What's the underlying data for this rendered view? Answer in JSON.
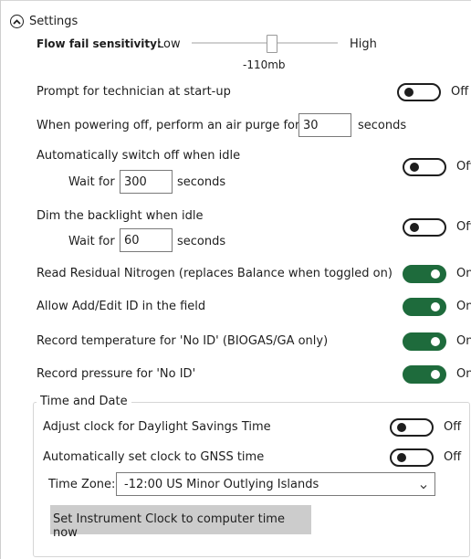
{
  "settings": {
    "title": "Settings",
    "flow_fail": {
      "label": "Flow fail sensitivity:",
      "low": "Low",
      "high": "High",
      "value": "-110mb"
    },
    "prompt_technician": {
      "label": "Prompt for technician at start-up",
      "state": "Off"
    },
    "air_purge": {
      "label": "When powering off, perform an air purge for",
      "value": "30",
      "unit": "seconds"
    },
    "auto_switch_off": {
      "label": "Automatically switch off when idle",
      "wait_label": "Wait for",
      "wait_value": "300",
      "unit": "seconds",
      "state": "Off"
    },
    "dim_backlight": {
      "label": "Dim the backlight when idle",
      "wait_label": "Wait for",
      "wait_value": "60",
      "unit": "seconds",
      "state": "Off"
    },
    "residual_nitrogen": {
      "label": "Read Residual Nitrogen (replaces Balance when toggled on)",
      "state": "On"
    },
    "add_edit_id": {
      "label": "Allow Add/Edit ID in the field",
      "state": "On"
    },
    "record_temp": {
      "label": "Record temperature for 'No ID' (BIOGAS/GA only)",
      "state": "On"
    },
    "record_pressure": {
      "label": "Record pressure for 'No ID'",
      "state": "On"
    }
  },
  "time_date": {
    "title": "Time and Date",
    "dst": {
      "label": "Adjust clock for Daylight Savings Time",
      "state": "Off"
    },
    "gnss": {
      "label": "Automatically set clock to GNSS time",
      "state": "Off"
    },
    "timezone": {
      "label": "Time Zone:",
      "value": "-12:00 US Minor Outlying Islands"
    },
    "set_clock_button": "Set Instrument Clock to computer time now"
  },
  "colors": {
    "toggle_on": "#1e6b3c",
    "toggle_off_border": "#1e1e1e"
  }
}
